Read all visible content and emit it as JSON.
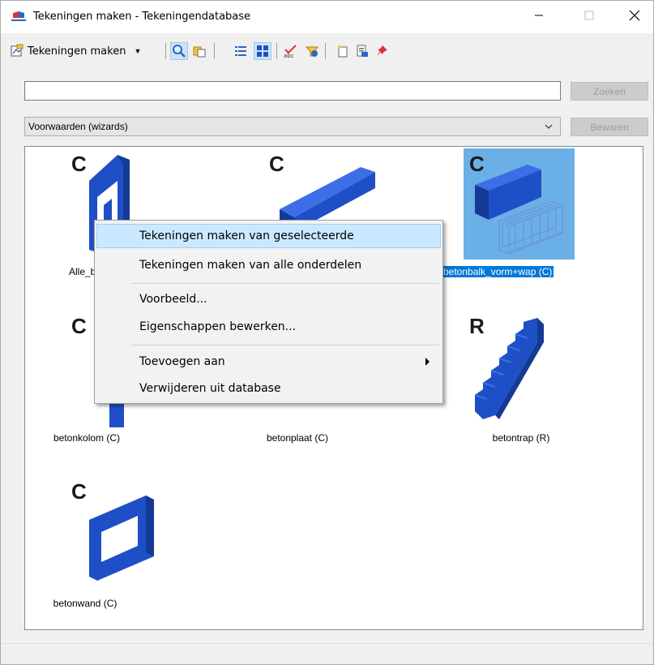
{
  "window": {
    "title": "Tekeningen maken - Tekeningendatabase"
  },
  "toolbar": {
    "mode_label": "Tekeningen maken",
    "buttons": [
      "search-icon",
      "copy-icon",
      "list-view-icon",
      "thumbnail-view-icon",
      "spellcheck-icon",
      "filter-icon",
      "new-icon",
      "properties-icon",
      "pin-icon"
    ]
  },
  "search": {
    "value": "",
    "button_label": "Zoeken"
  },
  "filter": {
    "selected": "Voorwaarden (wizards)",
    "save_label": "Bewaren"
  },
  "items": [
    {
      "letter": "C",
      "caption": "Alle_be",
      "shape": "frame-column"
    },
    {
      "letter": "C",
      "caption": "",
      "shape": "beam"
    },
    {
      "letter": "C",
      "caption": "betonbalk_vorm+wap (C)",
      "shape": "beam-rebar",
      "selected": true
    },
    {
      "letter": "C",
      "caption": "betonkolom (C)",
      "shape": "column"
    },
    {
      "letter": "",
      "caption": "betonplaat (C)",
      "shape": "slab"
    },
    {
      "letter": "R",
      "caption": "betontrap (R)",
      "shape": "stairs"
    },
    {
      "letter": "C",
      "caption": "betonwand (C)",
      "shape": "wall"
    }
  ],
  "context_menu": {
    "items": [
      {
        "label": "Tekeningen maken van geselecteerde",
        "hover": true
      },
      {
        "label": "Tekeningen maken van alle onderdelen"
      },
      {
        "label": "Voorbeeld..."
      },
      {
        "label": "Eigenschappen bewerken..."
      },
      {
        "label": "Toevoegen aan",
        "submenu": true
      },
      {
        "label": "Verwijderen uit database"
      }
    ]
  },
  "colors": {
    "accent": "#0078d7",
    "selection": "#6ab0e6",
    "concrete_blue": "#1f4fc6",
    "menu_hover": "#cce8ff"
  }
}
